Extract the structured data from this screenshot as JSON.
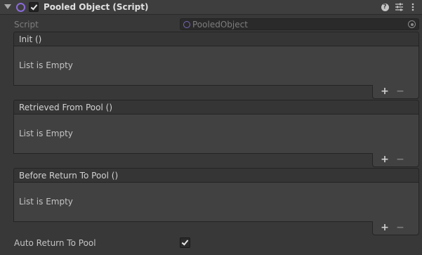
{
  "component": {
    "title": "Pooled Object (Script)",
    "enabled": true
  },
  "script_field": {
    "label": "Script",
    "value": "PooledObject"
  },
  "events": [
    {
      "label": "Init ()",
      "empty_text": "List is Empty",
      "add": "+",
      "remove": "−"
    },
    {
      "label": "Retrieved From Pool ()",
      "empty_text": "List is Empty",
      "add": "+",
      "remove": "−"
    },
    {
      "label": "Before Return To Pool ()",
      "empty_text": "List is Empty",
      "add": "+",
      "remove": "−"
    }
  ],
  "auto_return": {
    "label": "Auto Return To Pool",
    "checked": true
  },
  "icons": [
    "foldout-arrow-icon",
    "script-icon",
    "help-icon",
    "preset-icon",
    "menu-icon",
    "object-picker-icon"
  ]
}
